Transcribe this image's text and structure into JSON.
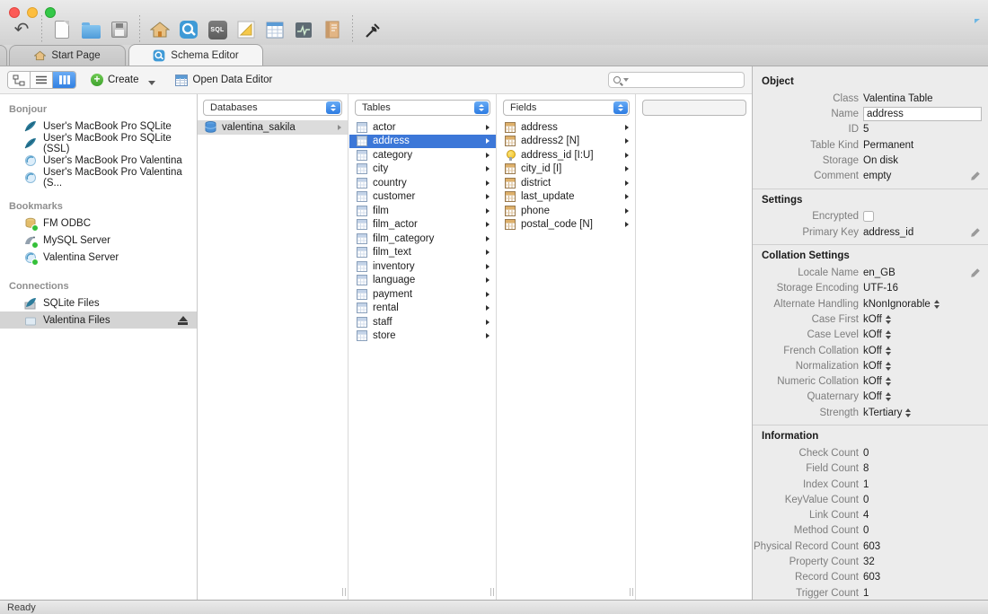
{
  "tabs": {
    "start_page": "Start Page",
    "schema_editor": "Schema Editor"
  },
  "toolbar": {
    "icon_names": [
      "undo-icon",
      "new-document-icon",
      "open-folder-icon",
      "save-icon",
      "start-page-icon",
      "schema-editor-icon",
      "sql-editor-icon",
      "diagram-editor-icon",
      "data-editor-icon",
      "server-admin-icon",
      "report-editor-icon",
      "connect-icon",
      "comment-bubble-icon"
    ],
    "sql_badge": "SQL"
  },
  "subtoolbar": {
    "create": "Create",
    "open_data_editor": "Open Data Editor",
    "search_placeholder": ""
  },
  "sidebar": {
    "bonjour_header": "Bonjour",
    "bonjour_items": [
      "User's MacBook Pro SQLite",
      "User's MacBook Pro SQLite (SSL)",
      "User's MacBook Pro Valentina",
      "User's MacBook Pro Valentina (S..."
    ],
    "bookmarks_header": "Bookmarks",
    "bookmarks_items": [
      "FM ODBC",
      "MySQL Server",
      "Valentina Server"
    ],
    "connections_header": "Connections",
    "connections_items": [
      "SQLite Files",
      "Valentina Files"
    ],
    "selected_item": "Valentina Files"
  },
  "browser": {
    "databases_header": "Databases",
    "databases_items": [
      "valentina_sakila"
    ],
    "tables_header": "Tables",
    "tables_items": [
      "actor",
      "address",
      "category",
      "city",
      "country",
      "customer",
      "film",
      "film_actor",
      "film_category",
      "film_text",
      "inventory",
      "language",
      "payment",
      "rental",
      "staff",
      "store"
    ],
    "tables_selected": "address",
    "fields_header": "Fields",
    "fields_items": [
      "address",
      "address2 [N]",
      "address_id [I:U]",
      "city_id [I]",
      "district",
      "last_update",
      "phone",
      "postal_code [N]"
    ]
  },
  "inspector": {
    "object_header": "Object",
    "class_label": "Class",
    "class_value": "Valentina Table",
    "name_label": "Name",
    "name_value": "address",
    "id_label": "ID",
    "id_value": "5",
    "table_kind_label": "Table Kind",
    "table_kind_value": "Permanent",
    "storage_label": "Storage",
    "storage_value": "On disk",
    "comment_label": "Comment",
    "comment_value": "empty",
    "settings_header": "Settings",
    "encrypted_label": "Encrypted",
    "primary_key_label": "Primary Key",
    "primary_key_value": "address_id",
    "collation_header": "Collation Settings",
    "collation_rows": [
      {
        "label": "Locale Name",
        "value": "en_GB"
      },
      {
        "label": "Storage Encoding",
        "value": "UTF-16"
      },
      {
        "label": "Alternate Handling",
        "value": "kNonIgnorable"
      },
      {
        "label": "Case First",
        "value": "kOff"
      },
      {
        "label": "Case Level",
        "value": "kOff"
      },
      {
        "label": "French Collation",
        "value": "kOff"
      },
      {
        "label": "Normalization",
        "value": "kOff"
      },
      {
        "label": "Numeric Collation",
        "value": "kOff"
      },
      {
        "label": "Quaternary",
        "value": "kOff"
      },
      {
        "label": "Strength",
        "value": "kTertiary"
      }
    ],
    "information_header": "Information",
    "info_rows": [
      {
        "label": "Check Count",
        "value": "0"
      },
      {
        "label": "Field Count",
        "value": "8"
      },
      {
        "label": "Index Count",
        "value": "1"
      },
      {
        "label": "KeyValue Count",
        "value": "0"
      },
      {
        "label": "Link Count",
        "value": "4"
      },
      {
        "label": "Method Count",
        "value": "0"
      },
      {
        "label": "Physical Record Count",
        "value": "603"
      },
      {
        "label": "Property Count",
        "value": "32"
      },
      {
        "label": "Record Count",
        "value": "603"
      },
      {
        "label": "Trigger Count",
        "value": "1"
      }
    ]
  },
  "statusbar": {
    "text": "Ready"
  },
  "colors": {
    "selection_blue": "#3c77d8",
    "accent_blue": "#3f9ad6",
    "status_green": "#35c03a"
  }
}
